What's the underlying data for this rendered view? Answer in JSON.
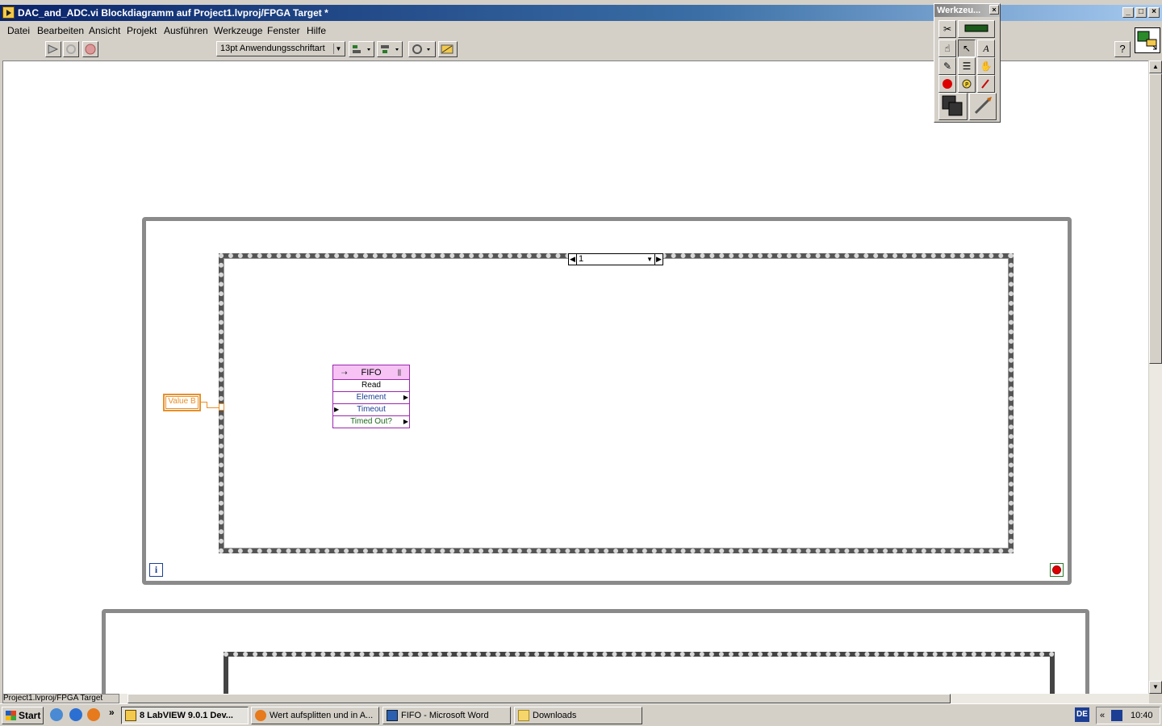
{
  "window": {
    "title": "DAC_and_ADC.vi Blockdiagramm auf Project1.lvproj/FPGA Target *"
  },
  "menu": [
    "Datei",
    "Bearbeiten",
    "Ansicht",
    "Projekt",
    "Ausführen",
    "Werkzeuge",
    "Fenster",
    "Hilfe"
  ],
  "toolbar": {
    "font_select": "13pt Anwendungsschriftart",
    "help": "?"
  },
  "tools_palette": {
    "title": "Werkzeu..."
  },
  "diagram": {
    "case_selector_value": "1",
    "iteration_terminal": "i",
    "value_b_label": "Value B",
    "fifo": {
      "name": "FIFO",
      "method": "Read",
      "terminals": [
        "Element",
        "Timeout",
        "Timed Out?"
      ]
    }
  },
  "status": {
    "context_path": "Project1.lvproj/FPGA Target"
  },
  "taskbar": {
    "start": "Start",
    "chevron": "»",
    "tasks": [
      "8 LabVIEW 9.0.1 Dev...",
      "Wert aufsplitten und in A...",
      "FIFO - Microsoft Word",
      "Downloads"
    ],
    "language": "DE",
    "tray_chevron": "«",
    "clock": "10:40"
  },
  "colors": {
    "accent_orange": "#e8902a",
    "fifo_purple": "#9c27b0",
    "fifo_header": "#f6c3f4",
    "loop_gray": "#8a8a8a"
  }
}
